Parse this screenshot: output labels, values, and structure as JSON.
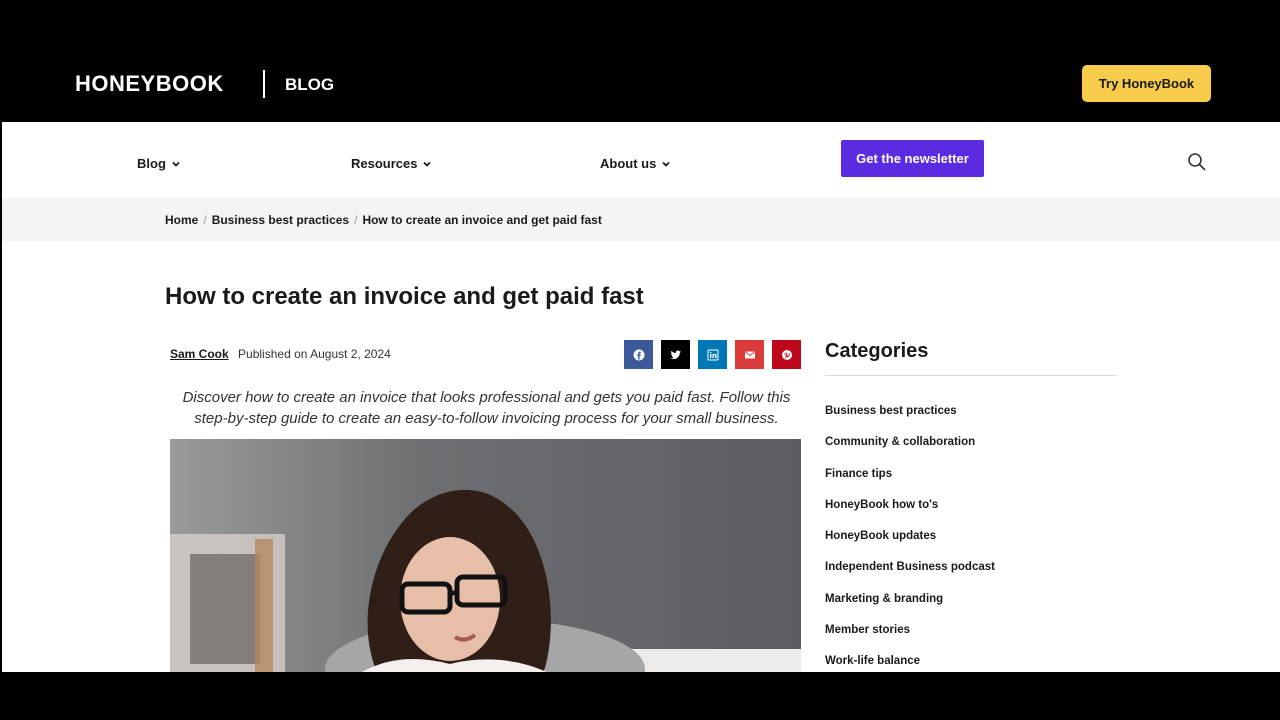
{
  "header": {
    "logo": "HONEYBOOK",
    "section": "BLOG",
    "cta_label": "Try HoneyBook"
  },
  "nav": {
    "items": [
      {
        "label": "Blog"
      },
      {
        "label": "Resources"
      },
      {
        "label": "About us"
      }
    ],
    "newsletter_label": "Get the newsletter",
    "search_icon": "search-icon"
  },
  "breadcrumb": {
    "items": [
      "Home",
      "Business best practices",
      "How to create an invoice and get paid fast"
    ],
    "separator": "/"
  },
  "article": {
    "title": "How to create an invoice and get paid fast",
    "author": "Sam Cook",
    "published": "Published on August 2, 2024",
    "intro": "Discover how to create an invoice that looks professional and gets you paid fast. Follow this step-by-step guide to create an easy-to-follow invoicing process for your small business.",
    "share": [
      {
        "icon": "facebook-icon",
        "color": "#3b5998"
      },
      {
        "icon": "twitter-icon",
        "color": "#000000"
      },
      {
        "icon": "linkedin-icon",
        "color": "#0077b5"
      },
      {
        "icon": "email-icon",
        "color": "#d93a3a"
      },
      {
        "icon": "pinterest-icon",
        "color": "#bd081c"
      }
    ]
  },
  "sidebar": {
    "title": "Categories",
    "categories": [
      "Business best practices",
      "Community & collaboration",
      "Finance tips",
      "HoneyBook how to's",
      "HoneyBook updates",
      "Independent Business podcast",
      "Marketing & branding",
      "Member stories",
      "Work-life balance"
    ]
  },
  "colors": {
    "cta": "#f7cc4a",
    "newsletter": "#5a2be0",
    "header_bg": "#000000",
    "breadcrumb_bg": "#f4f4f6"
  }
}
